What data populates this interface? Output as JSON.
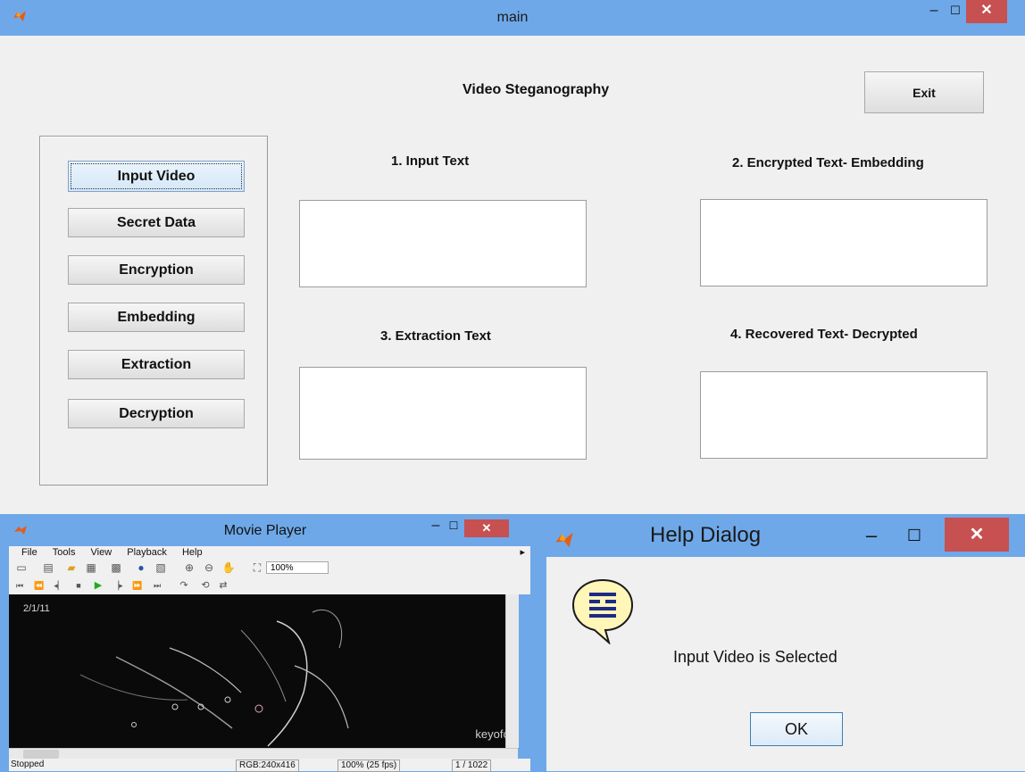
{
  "main": {
    "window_title": "main",
    "heading": "Video Steganography",
    "exit_label": "Exit",
    "buttons": [
      "Input Video",
      "Secret Data",
      "Encryption",
      "Embedding",
      "Extraction",
      "Decryption"
    ],
    "panels": {
      "input_text": "1. Input Text",
      "encrypted": "2. Encrypted  Text- Embedding",
      "extraction": "3. Extraction  Text",
      "recovered": "4. Recovered Text- Decrypted"
    }
  },
  "movie_player": {
    "window_title": "Movie Player",
    "menu": [
      "File",
      "Tools",
      "View",
      "Playback",
      "Help"
    ],
    "zoom": "100%",
    "date_overlay": "2/1/11",
    "watermark": "keyofc",
    "status": {
      "state": "Stopped",
      "format": "RGB:240x416",
      "rate": "100% (25 fps)",
      "frame": "1 / 1022"
    }
  },
  "help_dialog": {
    "window_title": "Help Dialog",
    "message": "Input Video is Selected",
    "ok_label": "OK"
  },
  "icons": {
    "window_controls": [
      "minimize-icon",
      "maximize-icon",
      "close-icon"
    ],
    "help": "help-speech-bubble-icon"
  },
  "colors": {
    "titlebar": "#6ea8e8",
    "close_button": "#c75050",
    "window_body": "#f0f0f0",
    "ok_border": "#3c7fb1"
  }
}
